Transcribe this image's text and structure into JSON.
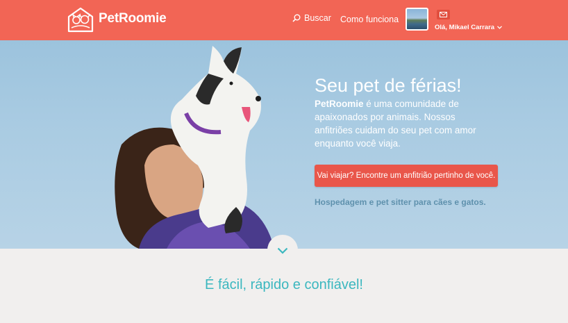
{
  "header": {
    "brand": "PetRoomie",
    "nav_search": "Buscar",
    "nav_how": "Como funciona",
    "user_greeting": "Olá, Mikael Carrara",
    "icons": {
      "logo": "house-pets-logo",
      "search": "search-icon",
      "mail": "mail-icon",
      "dropdown": "chevron-down-icon"
    }
  },
  "hero": {
    "title": "Seu pet de férias!",
    "desc_brand": "PetRoomie",
    "desc_rest": " é uma comunidade de apaixonados por animais. Nossos anfitriões cuidam do seu pet com amor enquanto você viaja.",
    "cta": "Vai viajar? Encontre um anfitrião pertinho de você.",
    "subtitle": "Hospedagem e pet sitter para cães e gatos."
  },
  "section": {
    "title": "É fácil, rápido e confiável!"
  },
  "colors": {
    "header": "#f26555",
    "cta": "#e9564a",
    "accent_teal": "#3bb7bf",
    "subtitle_blue": "#5f91ad"
  }
}
